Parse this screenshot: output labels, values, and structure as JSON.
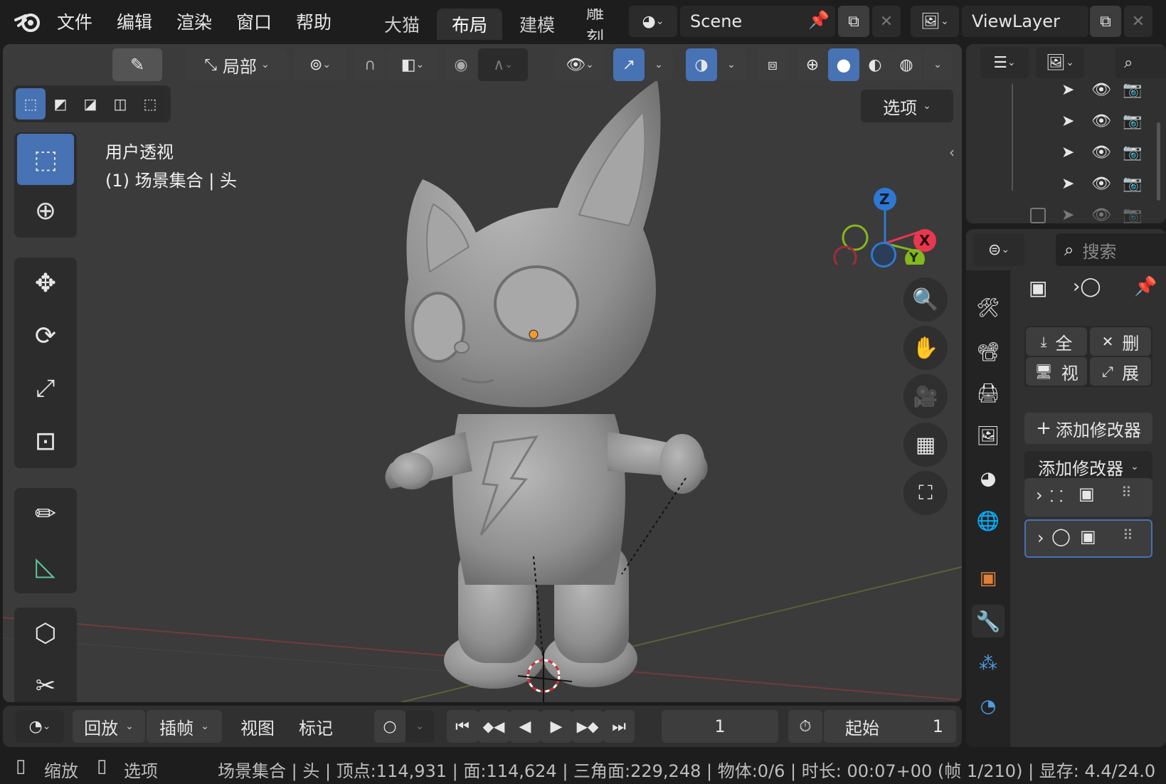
{
  "topbar": {
    "menus": [
      "文件",
      "编辑",
      "渲染",
      "窗口",
      "帮助"
    ],
    "workspaces": [
      "大猫",
      "布局",
      "建模",
      "雕刻"
    ],
    "active_workspace": "布局",
    "scene": "Scene",
    "view_layer": "ViewLayer"
  },
  "viewport": {
    "header": {
      "transform_orientation": "局部",
      "options_label": "选项"
    },
    "overlay_text": {
      "view_name": "用户透视",
      "collection_object": "(1) 场景集合 | 头"
    },
    "gizmo": {
      "z": "Z",
      "x": "X",
      "y": "Y"
    }
  },
  "outliner": {
    "rows": 5
  },
  "properties": {
    "search_placeholder": "搜索",
    "actions": {
      "apply_all": "全",
      "delete_all": "删",
      "viewport": "视",
      "expand": "展"
    },
    "add_modifier_button": "添加修改器",
    "add_modifier_dropdown": "添加修改器"
  },
  "timeline": {
    "playback": "回放",
    "keying": "插帧",
    "view": "视图",
    "marker": "标记",
    "current_frame": "1",
    "start_label": "起始",
    "start_value": "1"
  },
  "statusbar": {
    "zoom": "缩放",
    "select": "选项",
    "stats": "场景集合 | 头 | 顶点:114,931 | 面:114,624 | 三角面:229,248 | 物体:0/6 | 时长: 00:07+00 (帧 1/210) | 显存: 4.4/24.0"
  },
  "colors": {
    "accent": "#4772b3",
    "axis_x": "#e8374f",
    "axis_y": "#85b71e",
    "axis_z": "#2f78d1",
    "modifier_tab": "#4f9ae0",
    "object_tab": "#e0813a"
  }
}
